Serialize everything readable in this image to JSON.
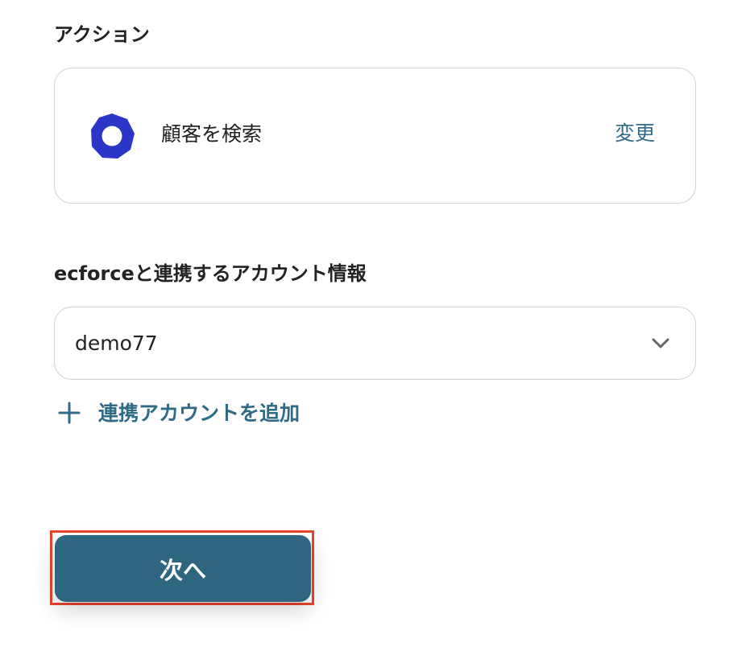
{
  "action_section": {
    "label": "アクション",
    "action_name": "顧客を検索",
    "change_label": "変更",
    "app_icon": "ecforce-octagon-ring-icon",
    "app_icon_color": "#2b35c8"
  },
  "account_section": {
    "label": "ecforceと連携するアカウント情報",
    "selected_account": "demo77",
    "add_account_label": "連携アカウントを追加"
  },
  "footer": {
    "next_label": "次へ"
  },
  "colors": {
    "accent": "#2f6a86",
    "button_bg": "#2e6680",
    "highlight_border": "#e8452c",
    "card_border": "#cfd2d6"
  }
}
